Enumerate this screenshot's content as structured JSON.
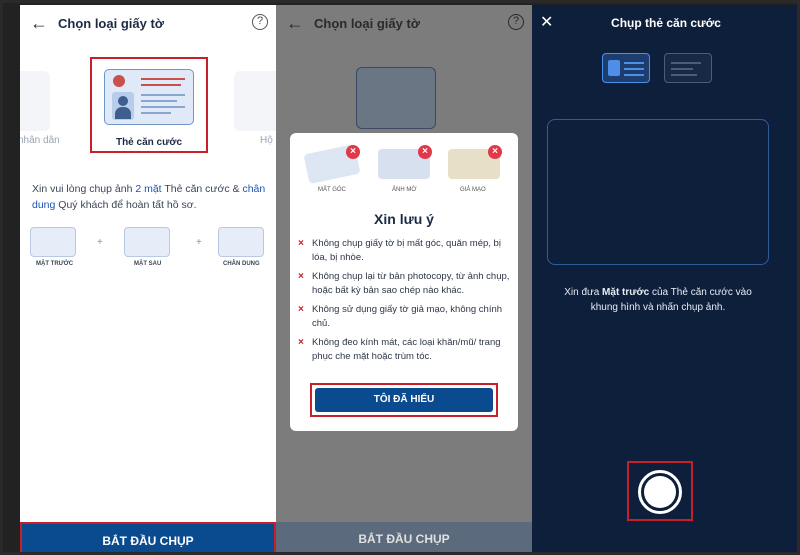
{
  "panel1": {
    "title": "Chọn loại giấy tờ",
    "back_icon": "←",
    "help_icon": "?",
    "left_card_label": "nhân dân",
    "selected_card_label": "Thẻ căn cước",
    "right_card_label": "Hộ",
    "instruction_part1": "Xin vui lòng chụp ảnh ",
    "instruction_hl1": "2 mặt",
    "instruction_part2": " Thẻ căn cước & ",
    "instruction_hl2": "chân dung",
    "instruction_part3": " Quý khách để hoàn tất hồ sơ.",
    "thumbs": [
      {
        "label": "MẶT TRƯỚC"
      },
      {
        "label": "MẶT SAU"
      },
      {
        "label": "CHÂN DUNG"
      }
    ],
    "plus": "+",
    "start_button": "BẮT ĐẦU CHỤP"
  },
  "panel2": {
    "title": "Chọn loại giấy tờ",
    "back_icon": "←",
    "help_icon": "?",
    "start_button": "BẮT ĐẦU CHỤP",
    "modal": {
      "examples": [
        {
          "label": "MẤT GÓC"
        },
        {
          "label": "ẢNH MỜ"
        },
        {
          "label": "GIẢ MẠO"
        }
      ],
      "title": "Xin lưu ý",
      "rules": [
        "Không chụp giấy tờ bị mất góc, quăn mép, bị lóa, bị nhòe.",
        "Không chụp lại từ bản photocopy, từ ảnh chụp, hoặc bất kỳ bản sao chép nào khác.",
        "Không sử dụng giấy tờ giả mạo, không chính chủ.",
        "Không đeo kính mát, các loại khăn/mũ/ trang phục che mặt hoặc trùm tóc."
      ],
      "x_mark": "×",
      "confirm_button": "TÔI ĐÃ HIỂU"
    }
  },
  "panel3": {
    "close_icon": "✕",
    "title": "Chụp thẻ căn cước",
    "instruction_part1": "Xin đưa ",
    "instruction_bold": "Mặt trước",
    "instruction_part2": " của Thẻ căn cước vào khung hình và nhấn chụp ảnh."
  },
  "colors": {
    "brand_blue": "#0a4a8f",
    "highlight_red": "#c8202a",
    "dark_navy": "#0e1f3b"
  }
}
